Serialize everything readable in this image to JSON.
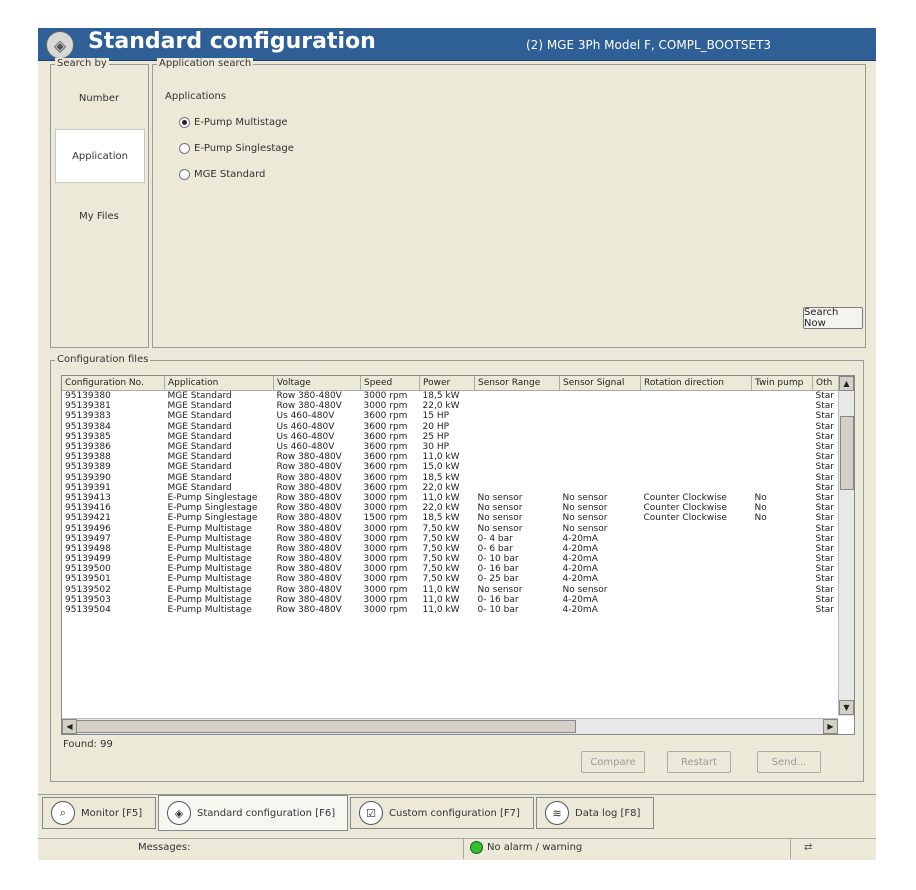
{
  "title": "Standard configuration",
  "device": "(2) MGE 3Ph Model F, COMPL_BOOTSET3",
  "search_by": {
    "legend": "Search by",
    "items": [
      "Number",
      "Application",
      "My Files"
    ],
    "selected": "Application"
  },
  "app_search": {
    "legend": "Application search",
    "applications_label": "Applications",
    "options": [
      "E-Pump Multistage",
      "E-Pump Singlestage",
      "MGE Standard"
    ],
    "selected": "E-Pump Multistage",
    "search_button": "Search Now"
  },
  "config_files": {
    "legend": "Configuration files",
    "columns": [
      "Configuration No.",
      "Application",
      "Voltage",
      "Speed",
      "Power",
      "Sensor Range",
      "Sensor Signal",
      "Rotation direction",
      "Twin pump",
      "Oth"
    ],
    "rows": [
      [
        "95139380",
        "MGE Standard",
        "Row 380-480V",
        "3000 rpm",
        "18,5 kW",
        "",
        "",
        "",
        "",
        "Star"
      ],
      [
        "95139381",
        "MGE Standard",
        "Row 380-480V",
        "3000 rpm",
        "22,0 kW",
        "",
        "",
        "",
        "",
        "Star"
      ],
      [
        "95139383",
        "MGE Standard",
        "Us 460-480V",
        "3600 rpm",
        "15 HP",
        "",
        "",
        "",
        "",
        "Star"
      ],
      [
        "95139384",
        "MGE Standard",
        "Us 460-480V",
        "3600 rpm",
        "20 HP",
        "",
        "",
        "",
        "",
        "Star"
      ],
      [
        "95139385",
        "MGE Standard",
        "Us 460-480V",
        "3600 rpm",
        "25 HP",
        "",
        "",
        "",
        "",
        "Star"
      ],
      [
        "95139386",
        "MGE Standard",
        "Us 460-480V",
        "3600 rpm",
        "30 HP",
        "",
        "",
        "",
        "",
        "Star"
      ],
      [
        "95139388",
        "MGE Standard",
        "Row 380-480V",
        "3600 rpm",
        "11,0 kW",
        "",
        "",
        "",
        "",
        "Star"
      ],
      [
        "95139389",
        "MGE Standard",
        "Row 380-480V",
        "3600 rpm",
        "15,0 kW",
        "",
        "",
        "",
        "",
        "Star"
      ],
      [
        "95139390",
        "MGE Standard",
        "Row 380-480V",
        "3600 rpm",
        "18,5 kW",
        "",
        "",
        "",
        "",
        "Star"
      ],
      [
        "95139391",
        "MGE Standard",
        "Row 380-480V",
        "3600 rpm",
        "22,0 kW",
        "",
        "",
        "",
        "",
        "Star"
      ],
      [
        "95139413",
        "E-Pump Singlestage",
        "Row 380-480V",
        "3000 rpm",
        "11,0 kW",
        "No sensor",
        "No sensor",
        "Counter Clockwise",
        "No",
        "Star"
      ],
      [
        "95139416",
        "E-Pump Singlestage",
        "Row 380-480V",
        "3000 rpm",
        "22,0 kW",
        "No sensor",
        "No sensor",
        "Counter Clockwise",
        "No",
        "Star"
      ],
      [
        "95139421",
        "E-Pump Singlestage",
        "Row 380-480V",
        "1500 rpm",
        "18,5 kW",
        "No sensor",
        "No sensor",
        "Counter Clockwise",
        "No",
        "Star"
      ],
      [
        "95139496",
        "E-Pump Multistage",
        "Row 380-480V",
        "3000 rpm",
        "7,50 kW",
        "No sensor",
        "No sensor",
        "",
        "",
        "Star"
      ],
      [
        "95139497",
        "E-Pump Multistage",
        "Row 380-480V",
        "3000 rpm",
        "7,50 kW",
        "0- 4 bar",
        "4-20mA",
        "",
        "",
        "Star"
      ],
      [
        "95139498",
        "E-Pump Multistage",
        "Row 380-480V",
        "3000 rpm",
        "7,50 kW",
        "0- 6 bar",
        "4-20mA",
        "",
        "",
        "Star"
      ],
      [
        "95139499",
        "E-Pump Multistage",
        "Row 380-480V",
        "3000 rpm",
        "7,50 kW",
        "0- 10 bar",
        "4-20mA",
        "",
        "",
        "Star"
      ],
      [
        "95139500",
        "E-Pump Multistage",
        "Row 380-480V",
        "3000 rpm",
        "7,50 kW",
        "0- 16 bar",
        "4-20mA",
        "",
        "",
        "Star"
      ],
      [
        "95139501",
        "E-Pump Multistage",
        "Row 380-480V",
        "3000 rpm",
        "7,50 kW",
        "0- 25 bar",
        "4-20mA",
        "",
        "",
        "Star"
      ],
      [
        "95139502",
        "E-Pump Multistage",
        "Row 380-480V",
        "3000 rpm",
        "11,0 kW",
        "No sensor",
        "No sensor",
        "",
        "",
        "Star"
      ],
      [
        "95139503",
        "E-Pump Multistage",
        "Row 380-480V",
        "3000 rpm",
        "11,0 kW",
        "0- 16 bar",
        "4-20mA",
        "",
        "",
        "Star"
      ],
      [
        "95139504",
        "E-Pump Multistage",
        "Row 380-480V",
        "3000 rpm",
        "11,0 kW",
        "0- 10 bar",
        "4-20mA",
        "",
        "",
        "Star"
      ]
    ],
    "found_label": "Found:",
    "found_count": "99",
    "buttons": {
      "compare": "Compare",
      "restart": "Restart",
      "send": "Send..."
    }
  },
  "tabs": [
    {
      "label": "Monitor [F5]",
      "icon": "magnifier-icon"
    },
    {
      "label": "Standard configuration [F6]",
      "icon": "standard-config-icon"
    },
    {
      "label": "Custom configuration [F7]",
      "icon": "custom-config-icon"
    },
    {
      "label": "Data log [F8]",
      "icon": "data-log-icon"
    }
  ],
  "active_tab": "Standard configuration [F6]",
  "status": {
    "messages_label": "Messages:",
    "alarm": "No alarm / warning",
    "alarm_color": "#2fbf2f"
  }
}
